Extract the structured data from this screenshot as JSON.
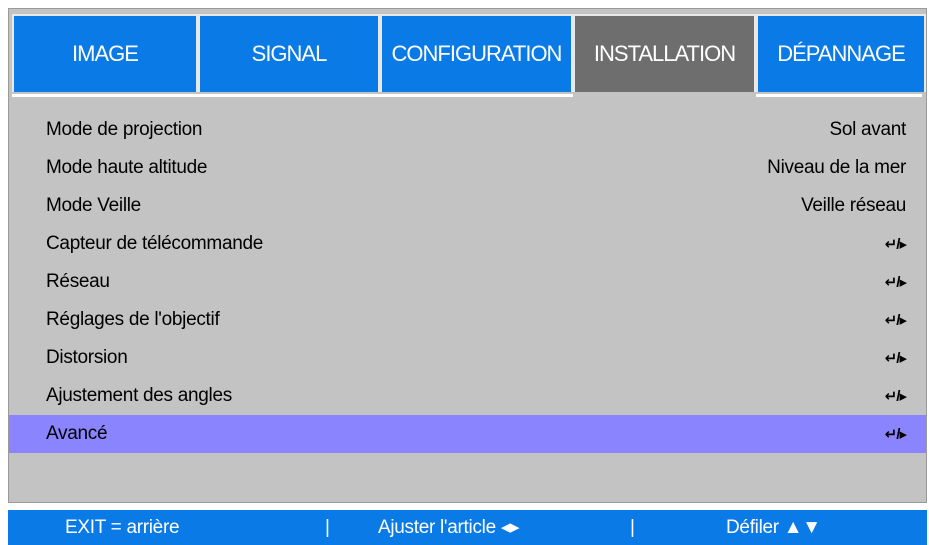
{
  "tabs": [
    {
      "label": "IMAGE",
      "active": false
    },
    {
      "label": "SIGNAL",
      "active": false
    },
    {
      "label": "CONFIGURATION",
      "active": false
    },
    {
      "label": "INSTALLATION",
      "active": true
    },
    {
      "label": "DÉPANNAGE",
      "active": false
    }
  ],
  "menu": {
    "items": [
      {
        "label": "Mode de projection",
        "value": "Sol avant"
      },
      {
        "label": "Mode haute altitude",
        "value": "Niveau de la mer"
      },
      {
        "label": "Mode Veille",
        "value": "Veille réseau"
      },
      {
        "label": "Capteur de télécommande",
        "value": "↵/▸"
      },
      {
        "label": "Réseau",
        "value": "↵/▸"
      },
      {
        "label": "Réglages de l'objectif",
        "value": "↵/▸"
      },
      {
        "label": "Distorsion",
        "value": "↵/▸"
      },
      {
        "label": "Ajustement des angles",
        "value": "↵/▸"
      },
      {
        "label": "Avancé",
        "value": "↵/▸",
        "selected": true
      }
    ]
  },
  "status": {
    "exit": "EXIT = arrière",
    "separator": "|",
    "adjust": "Ajuster l'article ◂▸",
    "scroll": "Défiler ▲▼"
  },
  "colors": {
    "tab_blue": "#0a7ae6",
    "tab_active": "#6e6e6e",
    "panel_gray": "#c3c3c3",
    "highlight": "#8a84ff",
    "status_blue": "#0a7ae6"
  }
}
